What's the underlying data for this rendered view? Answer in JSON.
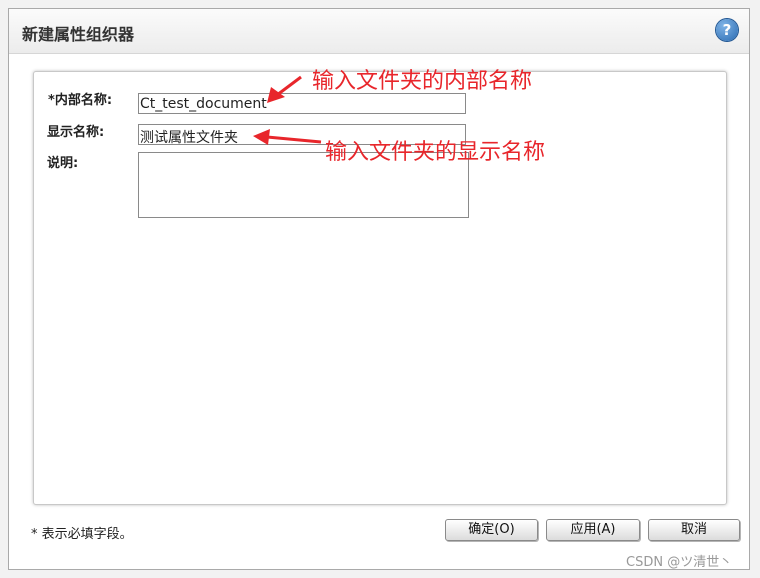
{
  "dialog": {
    "title": "新建属性组织器",
    "help_icon_glyph": "?"
  },
  "form": {
    "internal_name": {
      "required_mark": "*",
      "label": "内部名称:",
      "value": "Ct_test_document"
    },
    "display_name": {
      "label": "显示名称:",
      "value": "测试属性文件夹"
    },
    "description": {
      "label": "说明:",
      "value": ""
    }
  },
  "annotations": {
    "internal_name_hint": "输入文件夹的内部名称",
    "display_name_hint": "输入文件夹的显示名称",
    "color": "#e8262b"
  },
  "footer": {
    "required_note": "* 表示必填字段。",
    "ok_label": "确定(O)",
    "apply_label": "应用(A)",
    "cancel_label": "取消"
  },
  "watermark": "CSDN @ツ清世丶"
}
